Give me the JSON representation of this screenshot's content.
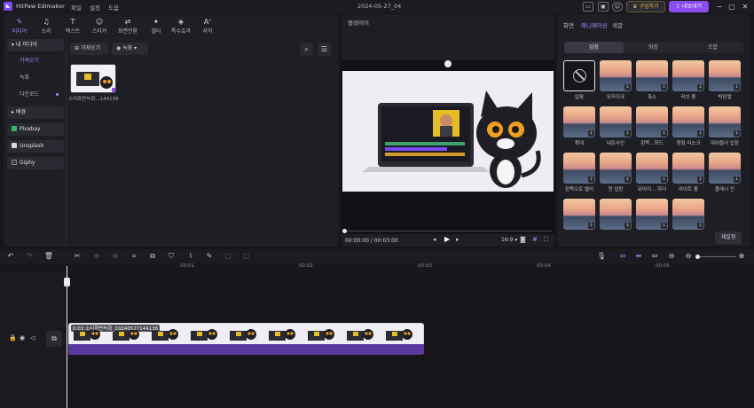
{
  "app": {
    "name": "HitPaw Edimakor",
    "title": "2024-05-27_04",
    "menu": [
      "파일",
      "설정",
      "도움"
    ],
    "buy_label": "구입하기",
    "export_label": "내보내기"
  },
  "media_toolbar": [
    {
      "label": "미디어",
      "icon": "media-icon"
    },
    {
      "label": "소리",
      "icon": "audio-icon"
    },
    {
      "label": "텍스트",
      "icon": "text-icon"
    },
    {
      "label": "스티커",
      "icon": "sticker-icon"
    },
    {
      "label": "화면전환",
      "icon": "transition-icon"
    },
    {
      "label": "필터",
      "icon": "filter-icon"
    },
    {
      "label": "특수효과",
      "icon": "effects-icon"
    },
    {
      "label": "자막",
      "icon": "subtitle-icon"
    }
  ],
  "sidebar": {
    "my_media": "내 미디어",
    "sub_items": [
      "가져오기",
      "녹화",
      "다운로드"
    ],
    "background": "배경",
    "pixabay": "Pixabay",
    "unsplash": "Unsplash",
    "giphy": "Giphy"
  },
  "media": {
    "import_label": "가져오기",
    "record_label": "녹화",
    "clip_name": "소리화면녹화...144136"
  },
  "player": {
    "title": "플레이어",
    "time": "00:00:00 / 00:03:00",
    "ratio": "16:9"
  },
  "anim_panel": {
    "tabs": [
      "화면",
      "애니메이션",
      "색깔"
    ],
    "segments": [
      "입장",
      "퇴장",
      "조합"
    ],
    "tiles": [
      "없음",
      "모자이크",
      "축소",
      "러브 줌",
      "박판쌓",
      "확대",
      "내온사인",
      "왼쪽...하드",
      "원형 마스크",
      "뛰어들어 입장",
      "왼쪽으로 밸러",
      "컷 입장",
      "뒤어지... 하더",
      "라이트 줌",
      "플래시 인",
      "",
      "",
      "",
      ""
    ],
    "reset_label": "재설정"
  },
  "timeline": {
    "ticks": [
      "00:01",
      "00:02",
      "00:03",
      "00:04",
      "00:05"
    ],
    "clip_label": "0:03  소리화면녹화_20240527144136"
  }
}
